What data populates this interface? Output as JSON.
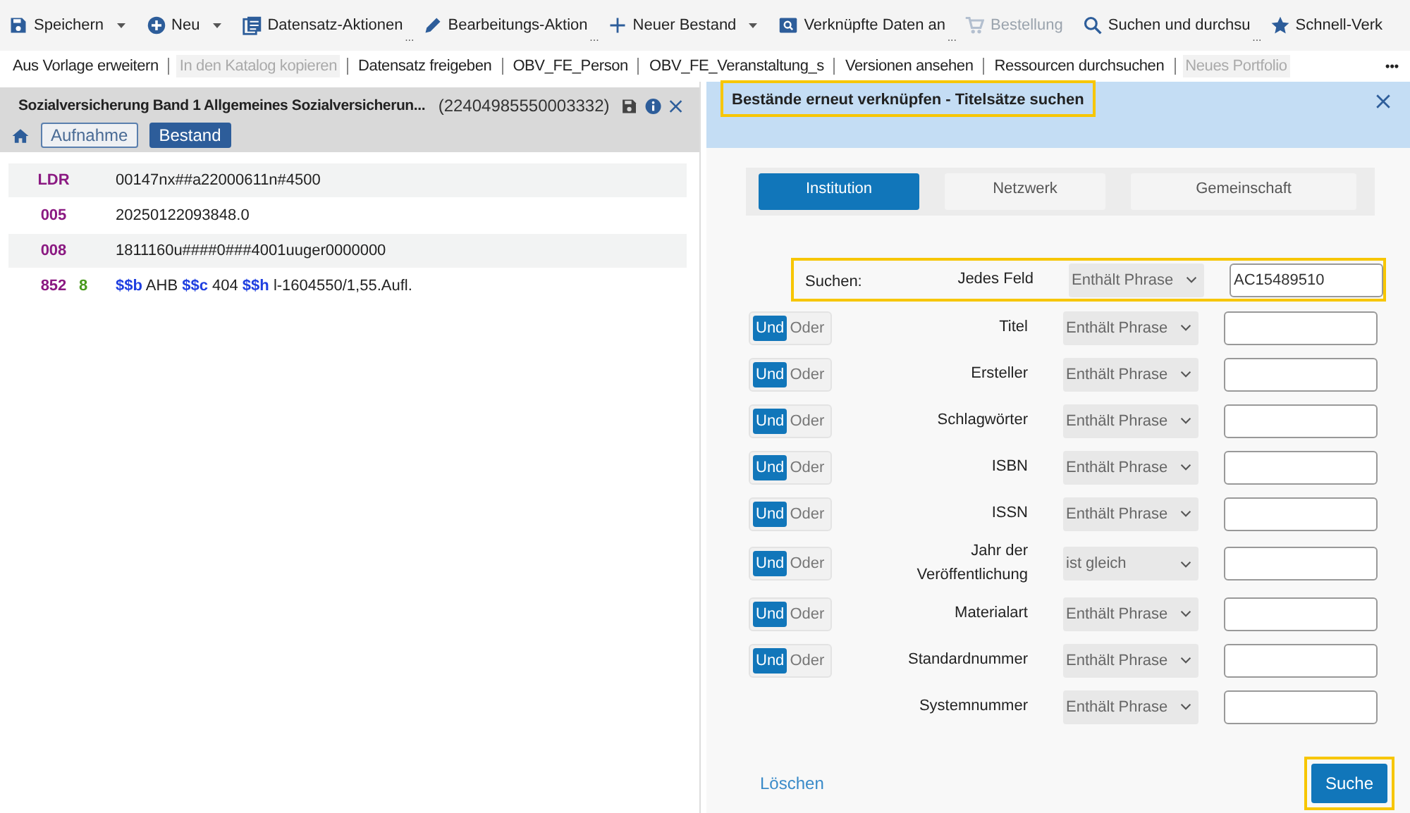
{
  "toolbar": [
    {
      "label": "Speichern",
      "dropdown": true,
      "disabled": false
    },
    {
      "label": "Neu",
      "dropdown": true,
      "disabled": false
    },
    {
      "label": "Datensatz-Aktionen",
      "dropdown": false,
      "ellipsis": "...",
      "disabled": false
    },
    {
      "label": "Bearbeitungs-Aktion",
      "dropdown": false,
      "ellipsis": "...",
      "disabled": false
    },
    {
      "label": "Neuer Bestand",
      "dropdown": true,
      "disabled": false
    },
    {
      "label": "Verknüpfte Daten an",
      "dropdown": false,
      "ellipsis": "...",
      "disabled": false
    },
    {
      "label": "Bestellung",
      "dropdown": false,
      "disabled": true
    },
    {
      "label": "Suchen und durchsu",
      "dropdown": false,
      "ellipsis": "...",
      "disabled": false
    },
    {
      "label": "Schnell-Verk",
      "dropdown": false,
      "disabled": false
    }
  ],
  "actions": [
    {
      "label": "Aus Vorlage erweitern",
      "disabled": false
    },
    {
      "label": "In den Katalog kopieren",
      "disabled": true
    },
    {
      "label": "Datensatz freigeben",
      "disabled": false
    },
    {
      "label": "OBV_FE_Person",
      "disabled": false
    },
    {
      "label": "OBV_FE_Veranstaltung_s",
      "disabled": false
    },
    {
      "label": "Versionen ansehen",
      "disabled": false
    },
    {
      "label": "Ressourcen durchsuchen",
      "disabled": false
    },
    {
      "label": "Neues Portfolio",
      "disabled": true
    }
  ],
  "more_button": "•••",
  "record": {
    "title": "Sozialversicherung Band 1 Allgemeines Sozialversicherun...",
    "id": "(22404985550003332)",
    "tabs": [
      {
        "label": "Aufnahme",
        "selected": false
      },
      {
        "label": "Bestand",
        "selected": true
      }
    ],
    "fields": [
      {
        "tag": "LDR",
        "value": "00147nx##a22000611n#4500"
      },
      {
        "tag": "005",
        "value": "20250122093848.0"
      },
      {
        "tag": "008",
        "value": "1811160u####0###4001uuger0000000"
      },
      {
        "tag": "852",
        "indicator": "8",
        "value": "**$$b** AHB **$$c** 404 **$$h** l-1604550/1,55.Aufl."
      }
    ]
  },
  "dialog": {
    "title": "Bestände erneut verknüpfen - Titelsätze suchen",
    "title_highlighted": true,
    "tabs": [
      {
        "label": "Institution",
        "selected": true
      },
      {
        "label": "Netzwerk",
        "selected": false
      },
      {
        "label": "Gemeinschaft",
        "selected": false
      }
    ],
    "rows": [
      {
        "prefix": "Suchen:",
        "field": "Jedes Feld",
        "operator": "Enthält Phrase",
        "value": "AC15489510",
        "highlighted": true
      },
      {
        "and": "Und",
        "or": "Oder",
        "and_selected": true,
        "field": "Titel",
        "operator": "Enthält Phrase",
        "highlighted": false
      },
      {
        "and": "Und",
        "or": "Oder",
        "and_selected": true,
        "field": "Ersteller",
        "operator": "Enthält Phrase",
        "highlighted": false
      },
      {
        "and": "Und",
        "or": "Oder",
        "and_selected": true,
        "field": "Schlagwörter",
        "operator": "Enthält Phrase",
        "highlighted": false
      },
      {
        "and": "Und",
        "or": "Oder",
        "and_selected": true,
        "field": "ISBN",
        "operator": "Enthält Phrase",
        "highlighted": false
      },
      {
        "and": "Und",
        "or": "Oder",
        "and_selected": true,
        "field": "ISSN",
        "operator": "Enthält Phrase",
        "highlighted": false
      },
      {
        "and": "Und",
        "or": "Oder",
        "and_selected": true,
        "field": "Jahr der Veröffentlichung",
        "operator": "ist gleich",
        "highlighted": false
      },
      {
        "and": "Und",
        "or": "Oder",
        "and_selected": true,
        "field": "Materialart",
        "operator": "Enthält Phrase",
        "highlighted": false
      },
      {
        "and": "Und",
        "or": "Oder",
        "and_selected": true,
        "field": "Standardnummer",
        "operator": "Enthält Phrase",
        "highlighted": false
      },
      {
        "field": "Systemnummer",
        "operator": "Enthält Phrase",
        "highlighted": false
      }
    ],
    "clear": "Löschen",
    "search": "Suche",
    "search_highlighted": true
  }
}
